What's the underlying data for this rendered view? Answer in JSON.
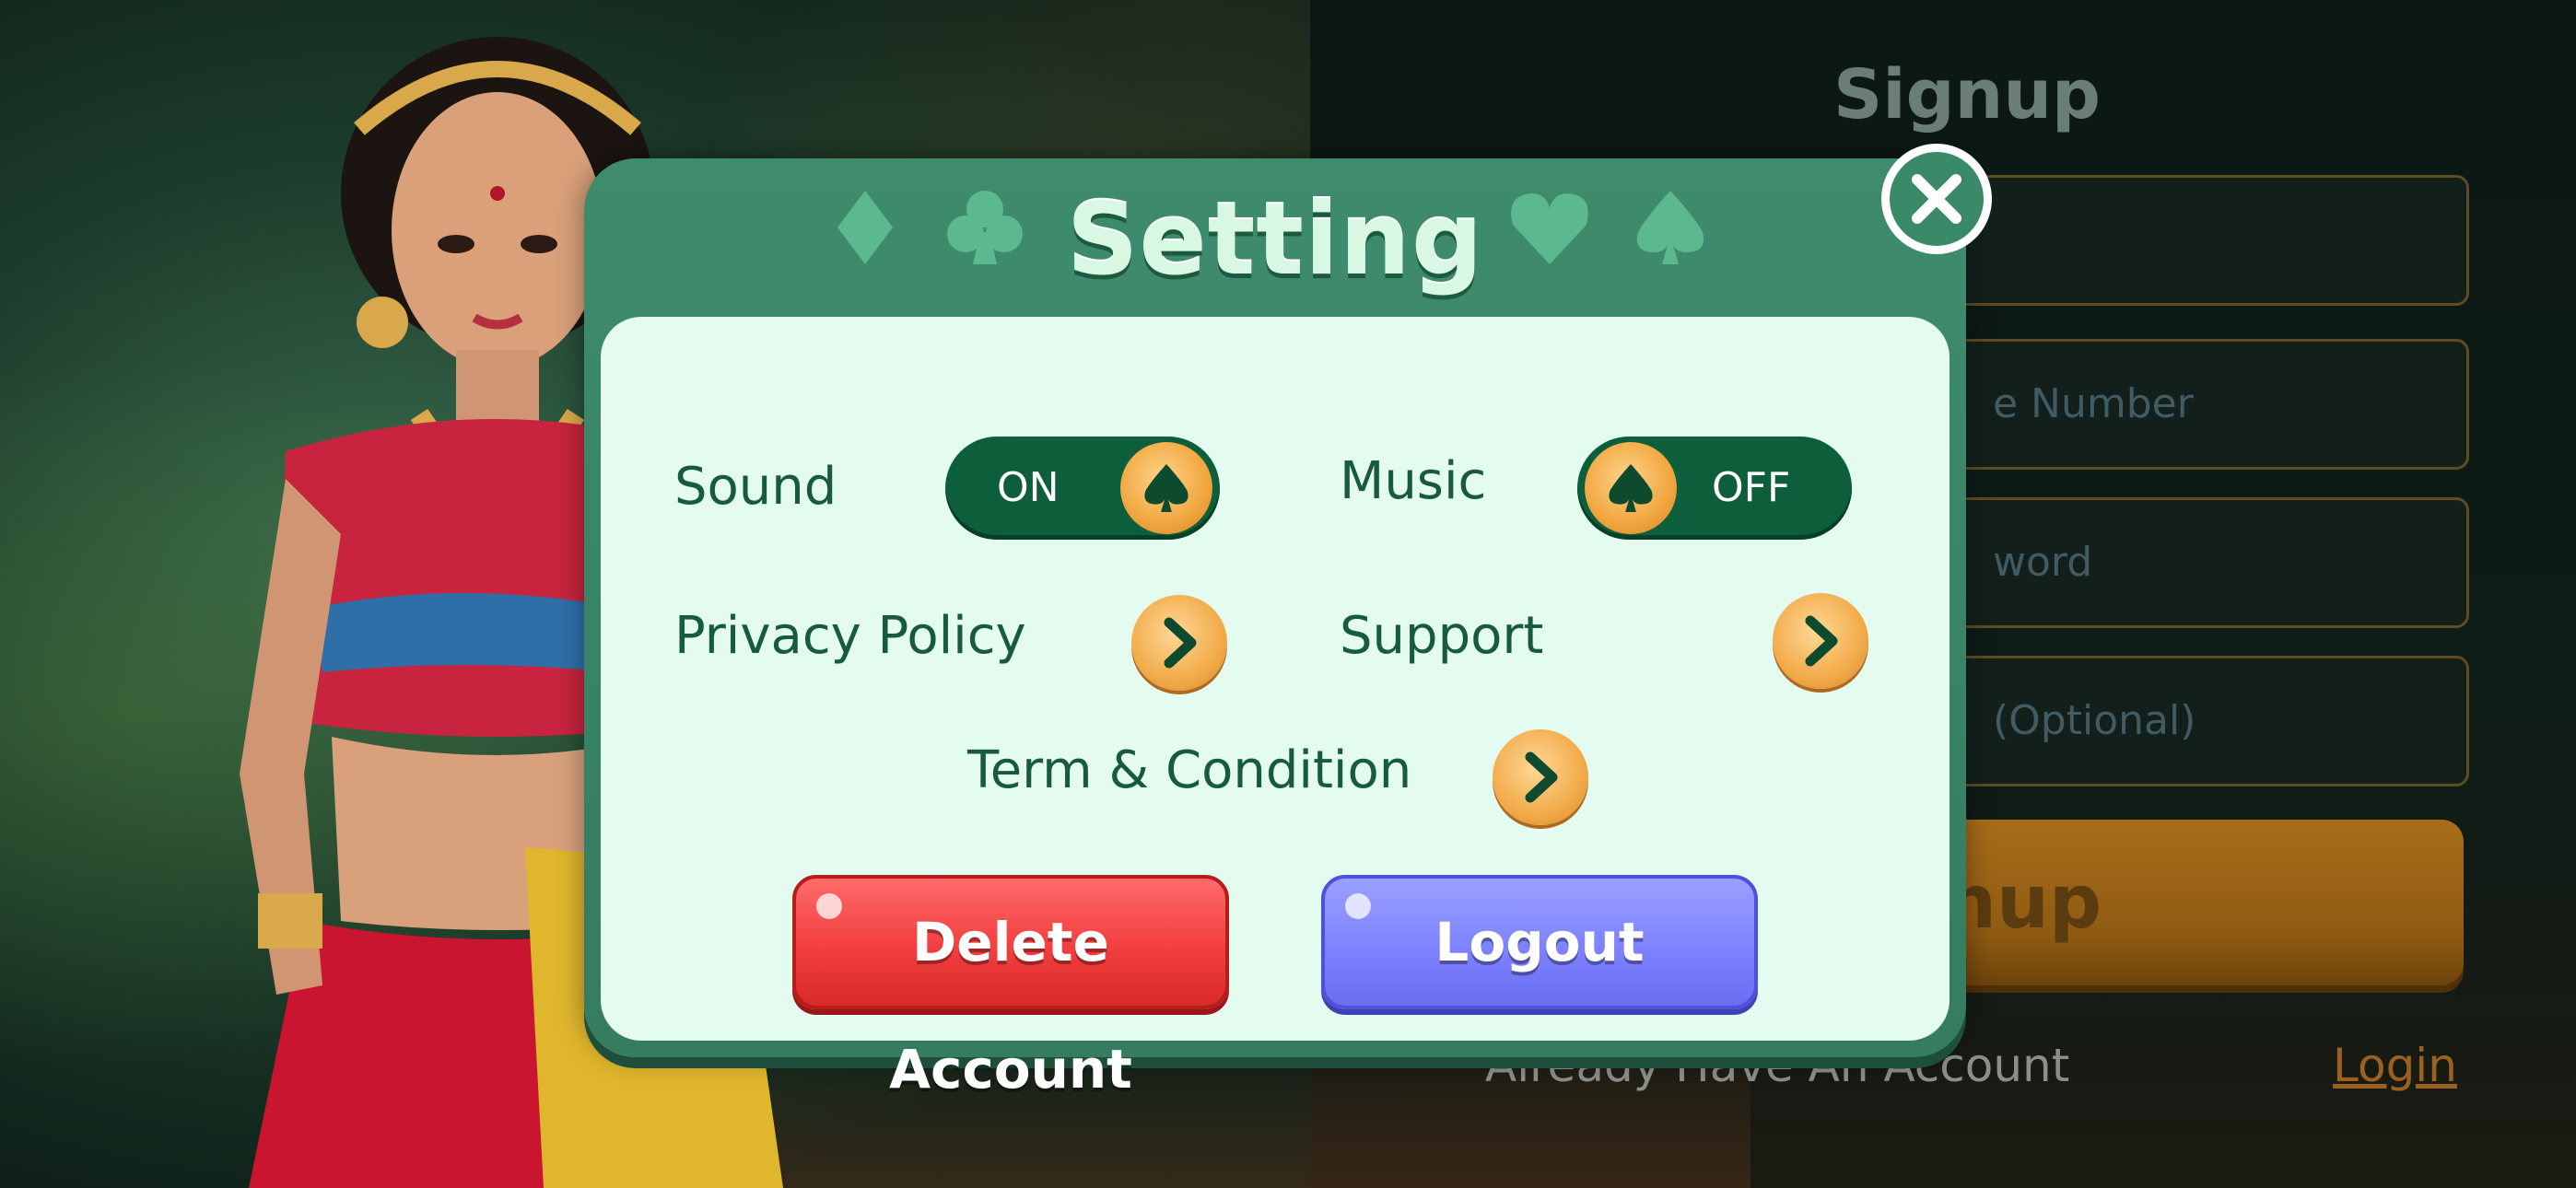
{
  "dialog": {
    "title": "Setting",
    "sound": {
      "label": "Sound",
      "state": "ON"
    },
    "music": {
      "label": "Music",
      "state": "OFF"
    },
    "privacy_policy_label": "Privacy Policy",
    "support_label": "Support",
    "terms_label": "Term & Condition",
    "delete_account_label": "Delete Account",
    "logout_label": "Logout",
    "suit_icons": [
      "diamond-icon",
      "club-icon",
      "heart-icon",
      "spade-icon"
    ],
    "close_icon": "close-icon"
  },
  "signup": {
    "title": "Signup",
    "fields": [
      {
        "placeholder": ""
      },
      {
        "placeholder": "e Number"
      },
      {
        "placeholder": "word"
      },
      {
        "placeholder": " (Optional)"
      }
    ],
    "button_label": "nup",
    "already_text": "Already Have An Account",
    "login_link": "Login"
  },
  "colors": {
    "dialog_header": "#3f8c6d",
    "dialog_panel": "#e4fbef",
    "toggle_bg": "#0d5e3a",
    "knob": "#f1a63f",
    "delete": "#f33e3e",
    "logout": "#7d82ff"
  }
}
